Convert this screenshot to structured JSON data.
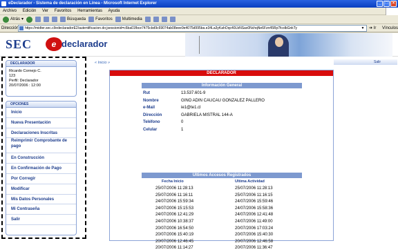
{
  "window": {
    "title": "eDeclarador - Sistema de declaración en Línea - Microsoft Internet Explorer"
  },
  "menu": [
    "Archivo",
    "Edición",
    "Ver",
    "Favoritos",
    "Herramientas",
    "Ayuda"
  ],
  "toolbar": {
    "back": "Atrás",
    "search": "Búsqueda",
    "favorites": "Favoritos",
    "multimedia": "Multimedia"
  },
  "address": {
    "label": "Dirección",
    "url": "https://midter.sec.cl/edeclaradorE2/autentificacion.do;jsessionid=c6ba01fbce7475cbd9c69074ab08eee9e4075d995ba.e34La3yKahOqc40LbNSax0NchqNe6Fzn45Rp7fcolbGnkTy",
    "go": "Ir",
    "links": "Vínculos"
  },
  "banner": {
    "sec_logo": "SEC",
    "e_logo": "e",
    "product": "declarador"
  },
  "declarador": {
    "header": "DECLARADOR",
    "name": "Ricardo Cornejo C.",
    "id": "123",
    "profile": "Perfil: Declarador",
    "datetime": "20/07/2006 : 12:00"
  },
  "options": {
    "header": "OPCIONES",
    "items": [
      "Inicio",
      "Nueva Presentación",
      "Declaraciones Inscritas",
      "Reimprimir Comprobante de pago",
      "En Construcción",
      "En Confirmación de Pago",
      "Por Corregir",
      "Modificar",
      "Mis Datos Personales",
      "Mi Contraseña",
      "Salir"
    ]
  },
  "breadcrumb": "« Inicio »",
  "salir": "Salir",
  "panel": {
    "title": "DECLARADOR",
    "general_header": "Información General",
    "general": [
      {
        "label": "Rut",
        "value": "13.537.601-9"
      },
      {
        "label": "Nombre",
        "value": "GINO ADIN CAUCAU GONZALEZ PALLERO"
      },
      {
        "label": "e-Mail",
        "value": "ie1@te1.cl"
      },
      {
        "label": "Dirección",
        "value": "GABRIELA MISTRAL 144-A"
      },
      {
        "label": "Teléfono",
        "value": "0"
      },
      {
        "label": "Celular",
        "value": "1"
      }
    ],
    "access_header": "Ultimos Accesos Registrados",
    "col_start": "Fecha Inicio",
    "col_last": "Ultima Actividad",
    "access": [
      [
        "25/07/2006 11:28:13",
        "25/07/2006 11:28:13"
      ],
      [
        "25/07/2006 11:16:11",
        "25/07/2006 11:16:15"
      ],
      [
        "24/07/2006 15:59:34",
        "24/07/2006 15:59:46"
      ],
      [
        "24/07/2006 15:15:53",
        "24/07/2006 15:58:36"
      ],
      [
        "24/07/2006 12:41:29",
        "24/07/2006 12:41:48"
      ],
      [
        "24/07/2006 10:38:37",
        "24/07/2006 11:49:00"
      ],
      [
        "20/07/2006 16:54:50",
        "20/07/2006 17:03:24"
      ],
      [
        "20/07/2006 15:40:19",
        "20/07/2006 15:40:30"
      ],
      [
        "20/07/2006 12:46:45",
        "20/07/2006 12:46:58"
      ],
      [
        "20/07/2006 11:14:27",
        "20/07/2006 11:36:47"
      ]
    ]
  }
}
